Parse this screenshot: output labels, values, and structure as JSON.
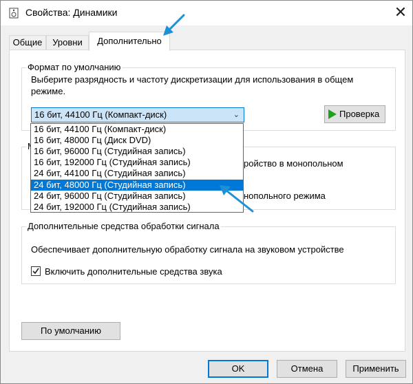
{
  "window": {
    "title": "Свойства: Динамики",
    "close_symbol": "✕"
  },
  "tabs": [
    {
      "label": "Общие"
    },
    {
      "label": "Уровни"
    },
    {
      "label": "Дополнительно"
    }
  ],
  "default_format": {
    "legend": "Формат по умолчанию",
    "description_line1": "Выберите разрядность и частоту дискретизации для использования в общем",
    "description_line2": "режиме.",
    "selected_value": "16 бит, 44100 Гц (Компакт-диск)",
    "test_button": "Проверка",
    "options": [
      "16 бит, 44100 Гц (Компакт-диск)",
      "16 бит, 48000 Гц (Диск DVD)",
      "16 бит, 96000 Гц (Студийная запись)",
      "16 бит, 192000 Гц (Студийная запись)",
      "24 бит, 44100 Гц (Студийная запись)",
      "24 бит, 48000 Гц (Студийная запись)",
      "24 бит, 96000 Гц (Студийная запись)",
      "24 бит, 192000 Гц (Студийная запись)"
    ],
    "highlighted_option": "24 бит, 48000 Гц (Студийная запись)"
  },
  "exclusive_mode": {
    "legend_partial": "М",
    "text_partial1": "ройство в монопольном",
    "text_partial2": "нопольного режима"
  },
  "enhancements": {
    "legend": "Дополнительные средства обработки сигнала",
    "description": "Обеспечивает дополнительную обработку сигнала на звуковом устройстве",
    "checkbox_label": "Включить дополнительные средства звука",
    "checked": true
  },
  "buttons": {
    "defaults": "По умолчанию",
    "ok": "OK",
    "cancel": "Отмена",
    "apply": "Применить"
  },
  "colors": {
    "accent": "#0078d7",
    "arrow": "#1e90d6",
    "play_icon": "#1fa31f"
  }
}
